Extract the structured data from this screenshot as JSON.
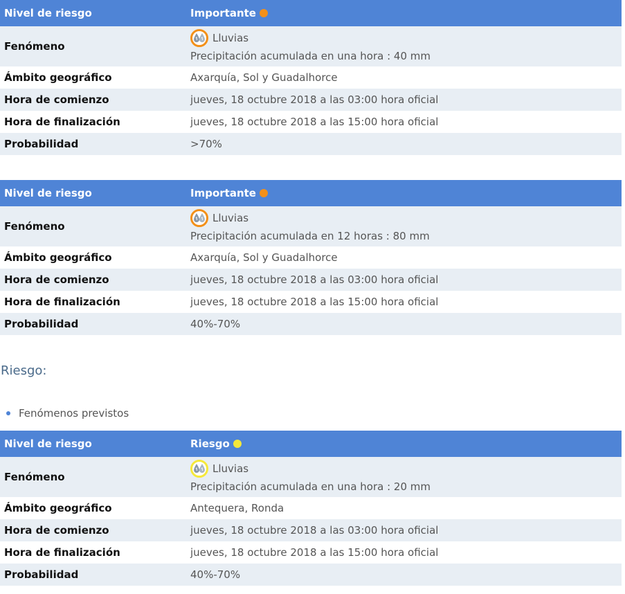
{
  "labels": {
    "nivel": "Nivel de riesgo",
    "fenomeno": "Fenómeno",
    "ambito": "Ámbito geográfico",
    "comienzo": "Hora de comienzo",
    "finalizacion": "Hora de finalización",
    "probabilidad": "Probabilidad"
  },
  "warnings": [
    {
      "level": "Importante",
      "level_color": "#f39019",
      "phenomenon": "Lluvias",
      "detail": "Precipitación acumulada en una hora : 40 mm",
      "area": "Axarquía, Sol y Guadalhorce",
      "start": "jueves, 18 octubre 2018 a las 03:00 hora oficial",
      "end": "jueves, 18 octubre 2018 a las 15:00 hora oficial",
      "probability": ">70%"
    },
    {
      "level": "Importante",
      "level_color": "#f39019",
      "phenomenon": "Lluvias",
      "detail": "Precipitación acumulada en 12 horas : 80 mm",
      "area": "Axarquía, Sol y Guadalhorce",
      "start": "jueves, 18 octubre 2018 a las 03:00 hora oficial",
      "end": "jueves, 18 octubre 2018 a las 15:00 hora oficial",
      "probability": "40%-70%"
    },
    {
      "level": "Riesgo",
      "level_color": "#f5e83a",
      "phenomenon": "Lluvias",
      "detail": "Precipitación acumulada en una hora : 20 mm",
      "area": "Antequera, Ronda",
      "start": "jueves, 18 octubre 2018 a las 03:00 hora oficial",
      "end": "jueves, 18 octubre 2018 a las 15:00 hora oficial",
      "probability": "40%-70%"
    }
  ],
  "section": {
    "heading": "Riesgo:",
    "bullet": "Fenómenos previstos"
  },
  "icons": {
    "phenomenon": "rain-drops-icon",
    "level": "level-dot-icon"
  }
}
